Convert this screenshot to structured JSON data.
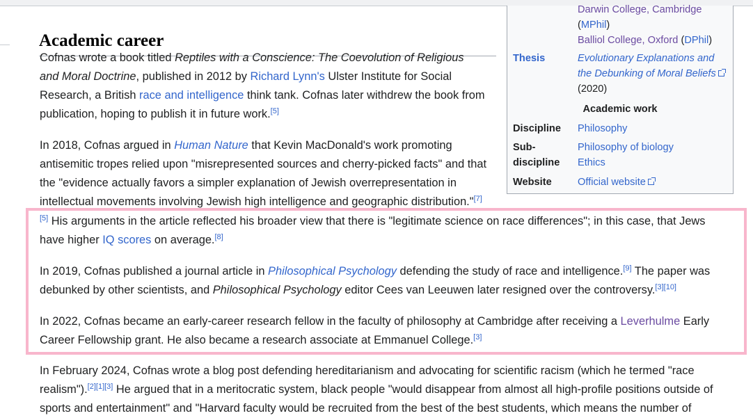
{
  "heading": "Academic career",
  "infobox": {
    "alma_mater_1": "Darwin College, Cambridge",
    "mphil_open": "(",
    "mphil": "MPhil",
    "mphil_close": ")",
    "alma_mater_2": "Balliol College, Oxford",
    "dphil_open": " (",
    "dphil": "DPhil",
    "dphil_close": ")",
    "thesis_label": "Thesis",
    "thesis_title": "Evolutionary Explanations and the Debunking of Moral Beliefs",
    "thesis_year": " (2020)",
    "section": "Academic work",
    "discipline_label": "Discipline",
    "discipline": "Philosophy",
    "subdiscipline_label_1": "Sub-",
    "subdiscipline_label_2": "discipline",
    "subdiscipline_1": "Philosophy of biology",
    "subdiscipline_2": "Ethics",
    "website_label": "Website",
    "website": "Official website"
  },
  "p1": {
    "t1": "Cofnas wrote a book titled ",
    "book": "Reptiles with a Conscience: The Coevolution of Religious and Moral Doctrine",
    "t2": ", published in 2012 by ",
    "l1": "Richard Lynn's",
    "t3": " Ulster Institute for Social Research, a British ",
    "l2": "race and intelligence",
    "t4": " think tank. Cofnas later withdrew the book from publication, hoping to publish it in future work.",
    "ref": "[5]"
  },
  "p2": {
    "t1": "In 2018, Cofnas argued in ",
    "l1": "Human Nature",
    "t2": " that Kevin MacDonald's work promoting antisemitic tropes relied upon \"misrepresented sources and cherry-picked facts\" and that the \"evidence actually favors a simpler explanation of Jewish overrepresentation in intellectual movements involving Jewish high intelligence and geographic distribution.\"",
    "ref1": "[7]"
  },
  "p3": {
    "ref": "[5]",
    "t1": " His arguments in the article reflected his broader view that there is \"legitimate science on race differences\"; in this case, that Jews have higher ",
    "l1": "IQ scores",
    "t2": " on average.",
    "ref2": "[8]"
  },
  "p4": {
    "t1": "In 2019, Cofnas published a journal article in ",
    "l1": "Philosophical Psychology",
    "t2": " defending the study of race and intelligence.",
    "ref1": "[9]",
    "t3": " The paper was debunked by other scientists, and ",
    "i1": "Philosophical Psychology",
    "t4": " editor Cees van Leeuwen later resigned over the controversy.",
    "ref2": "[3]",
    "ref3": "[10]"
  },
  "p5": {
    "t1": "In 2022, Cofnas became an early-career research fellow in the faculty of philosophy at Cambridge after receiving a ",
    "l1": "Leverhulme",
    "t2": " Early Career Fellowship grant. He also became a research associate at Emmanuel College.",
    "ref": "[3]"
  },
  "p6": {
    "t1": "In February 2024, Cofnas wrote a blog post defending hereditarianism and advocating for scientific racism (which he termed \"race realism\").",
    "ref1": "[2]",
    "ref2": "[1]",
    "ref3": "[3]",
    "t2": " He argued that in a meritocratic system, black people \"would disappear from almost all high-profile positions outside of sports and entertainment\" and \"Harvard faculty would be recruited from the best of the best students, which means the number of"
  }
}
